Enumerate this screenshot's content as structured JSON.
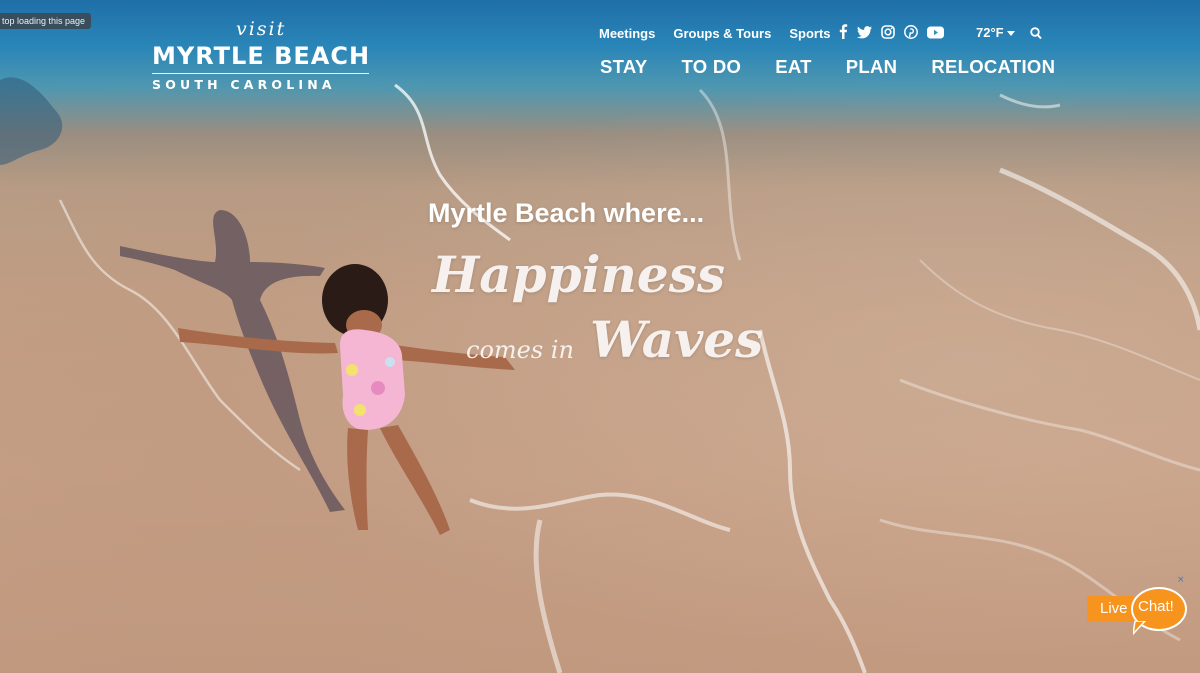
{
  "browser": {
    "status_tip": "top loading this page"
  },
  "logo": {
    "visit": "visit",
    "name": "MYRTLE BEACH",
    "region": "SOUTH CAROLINA"
  },
  "topnav": {
    "links": [
      "Meetings",
      "Groups & Tours",
      "Sports"
    ]
  },
  "social": {
    "icons": [
      "facebook-icon",
      "twitter-icon",
      "instagram-icon",
      "pinterest-icon",
      "youtube-icon"
    ]
  },
  "weather": {
    "temp": "72°F"
  },
  "mainnav": {
    "items": [
      "STAY",
      "TO DO",
      "EAT",
      "PLAN",
      "RELOCATION"
    ]
  },
  "hero": {
    "line1": "Myrtle Beach where...",
    "line2": "Happiness",
    "line3": "comes in",
    "line4": "Waves"
  },
  "chat": {
    "live": "Live",
    "chat": "Chat!",
    "close": "×"
  },
  "colors": {
    "chat_orange": "#f7941d",
    "sea_blue": "#2a86b8",
    "sand": "#c39f85"
  }
}
